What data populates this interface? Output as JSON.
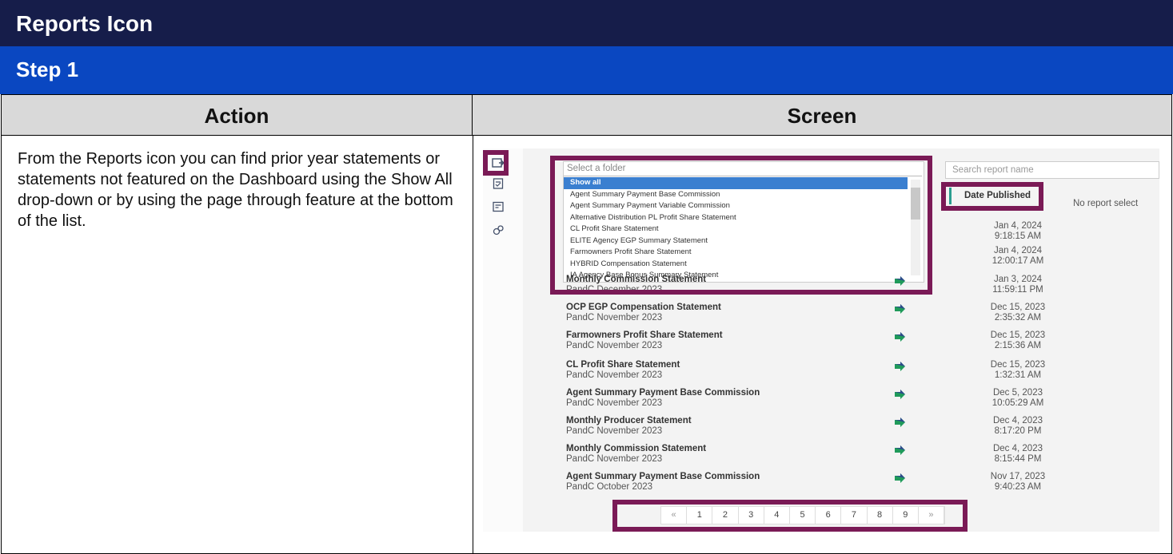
{
  "title": "Reports Icon",
  "step": "Step 1",
  "table": {
    "action_header": "Action",
    "screen_header": "Screen",
    "action_text": "From the Reports icon you can find prior year statements or statements not featured on the Dashboard using the Show All drop-down or by using the page through feature at the bottom of the list."
  },
  "screenshot": {
    "folder_placeholder": "Select a folder",
    "folder_options": [
      "Show all",
      "Agent Summary Payment Base Commission",
      "Agent Summary Payment Variable Commission",
      "Alternative Distribution PL Profit Share Statement",
      "CL Profit Share Statement",
      "ELITE Agency EGP Summary Statement",
      "Farmowners Profit Share Statement",
      "HYBRID Compensation Statement",
      "IA Agency Base Bonus Summary Statement"
    ],
    "search_placeholder": "Search report name",
    "date_published_label": "Date Published",
    "no_report_text": "No report select",
    "hidden_rows": [
      {
        "date": "Jan 4, 2024",
        "time": "9:18:15 AM"
      },
      {
        "date": "Jan 4, 2024",
        "time": "12:00:17 AM"
      }
    ],
    "reports": [
      {
        "title": "Monthly Commission Statement",
        "subtitle": "PandC December 2023",
        "date": "Jan 3, 2024",
        "time": "11:59:11 PM"
      },
      {
        "title": "OCP EGP Compensation Statement",
        "subtitle": "PandC November 2023",
        "date": "Dec 15, 2023",
        "time": "2:35:32 AM"
      },
      {
        "title": "Farmowners Profit Share Statement",
        "subtitle": "PandC November 2023",
        "date": "Dec 15, 2023",
        "time": "2:15:36 AM"
      },
      {
        "title": "CL Profit Share Statement",
        "subtitle": "PandC November 2023",
        "date": "Dec 15, 2023",
        "time": "1:32:31 AM"
      },
      {
        "title": "Agent Summary Payment Base Commission",
        "subtitle": "PandC November 2023",
        "date": "Dec 5, 2023",
        "time": "10:05:29 AM"
      },
      {
        "title": "Monthly Producer Statement",
        "subtitle": "PandC November 2023",
        "date": "Dec 4, 2023",
        "time": "8:17:20 PM"
      },
      {
        "title": "Monthly Commission Statement",
        "subtitle": "PandC November 2023",
        "date": "Dec 4, 2023",
        "time": "8:15:44 PM"
      },
      {
        "title": "Agent Summary Payment Base Commission",
        "subtitle": "PandC October 2023",
        "date": "Nov 17, 2023",
        "time": "9:40:23 AM"
      }
    ],
    "pager": [
      "«",
      "1",
      "2",
      "3",
      "4",
      "5",
      "6",
      "7",
      "8",
      "9",
      "»"
    ],
    "sidebar_icons": [
      "reports-icon",
      "document-check-icon",
      "statement-icon",
      "settings-gear-icon"
    ],
    "colors": {
      "title_bar": "#161d4a",
      "step_bar": "#0a47c1",
      "header_gray": "#d9d9d9",
      "highlight": "#7a1a56",
      "selected_option": "#3a7fd0"
    }
  }
}
